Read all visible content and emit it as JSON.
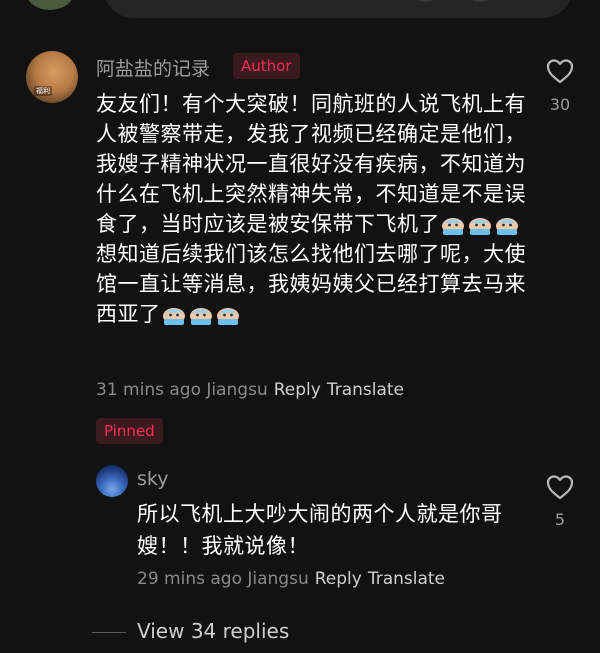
{
  "comment": {
    "username": "阿盐盐的记录",
    "author_badge": "Author",
    "text_part1": "友友们！有个大突破！同航班的人说飞机上有人被警察带走，发我了视频已经确定是他们，我嫂子精神状况一直很好没有疾病，不知道为什么在飞机上突然精神失常，不知道是不是误食了，当时应该是被安保带下飞机了",
    "text_part2": "想知道后续我们该怎么找他们去哪了呢，大使馆一直让等消息，我姨妈姨父已经打算去马来西亚了",
    "time": "31 mins ago",
    "location": "Jiangsu",
    "reply_label": "Reply",
    "translate_label": "Translate",
    "pinned_badge": "Pinned",
    "like_count": "30",
    "avatar_caption": "福利"
  },
  "reply": {
    "username": "sky",
    "text": "所以飞机上大吵大闹的两个人就是你哥嫂！！我就说像！",
    "time": "29 mins ago",
    "location": "Jiangsu",
    "reply_label": "Reply",
    "translate_label": "Translate",
    "like_count": "5"
  },
  "view_replies_label": "View 34 replies",
  "icons": {
    "like": "heart-outline-icon",
    "emoji": "crying-face-emoji"
  },
  "colors": {
    "background": "#121212",
    "accent": "#fe2c55",
    "secondary_text": "#9c9c9c"
  }
}
